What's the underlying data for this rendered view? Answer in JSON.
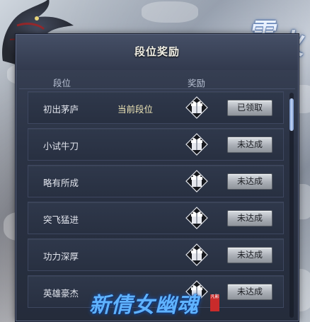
{
  "panel": {
    "title": "段位奖励",
    "col_rank": "段位",
    "col_reward": "奖励"
  },
  "rows": [
    {
      "name": "初出茅庐",
      "status": "当前段位",
      "button": "已领取"
    },
    {
      "name": "小试牛刀",
      "status": "",
      "button": "未达成"
    },
    {
      "name": "略有所成",
      "status": "",
      "button": "未达成"
    },
    {
      "name": "突飞猛进",
      "status": "",
      "button": "未达成"
    },
    {
      "name": "功力深厚",
      "status": "",
      "button": "未达成"
    },
    {
      "name": "英雄豪杰",
      "status": "",
      "button": "未达成"
    }
  ],
  "icons": {
    "reward": "gift-box-icon",
    "ornament": "dragon-ornament",
    "logo": "calligraphy-logo"
  },
  "logo": {
    "game_name": "新倩女幽魂",
    "top_right_chars": [
      "雷",
      "火"
    ],
    "seal_text": "凡影"
  },
  "colors": {
    "panel_bg": "#2a3244",
    "status_text": "#f0e7b8",
    "button_bg": "#b4b9c0",
    "logo_blue": "#5fb2ff"
  },
  "scroll": {
    "position": 0
  }
}
